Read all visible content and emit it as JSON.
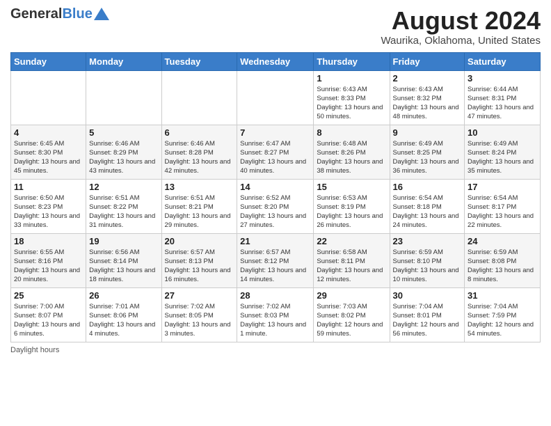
{
  "header": {
    "logo_general": "General",
    "logo_blue": "Blue",
    "main_title": "August 2024",
    "subtitle": "Waurika, Oklahoma, United States"
  },
  "calendar": {
    "days_of_week": [
      "Sunday",
      "Monday",
      "Tuesday",
      "Wednesday",
      "Thursday",
      "Friday",
      "Saturday"
    ],
    "weeks": [
      [
        {
          "day": "",
          "info": ""
        },
        {
          "day": "",
          "info": ""
        },
        {
          "day": "",
          "info": ""
        },
        {
          "day": "",
          "info": ""
        },
        {
          "day": "1",
          "info": "Sunrise: 6:43 AM\nSunset: 8:33 PM\nDaylight: 13 hours and 50 minutes."
        },
        {
          "day": "2",
          "info": "Sunrise: 6:43 AM\nSunset: 8:32 PM\nDaylight: 13 hours and 48 minutes."
        },
        {
          "day": "3",
          "info": "Sunrise: 6:44 AM\nSunset: 8:31 PM\nDaylight: 13 hours and 47 minutes."
        }
      ],
      [
        {
          "day": "4",
          "info": "Sunrise: 6:45 AM\nSunset: 8:30 PM\nDaylight: 13 hours and 45 minutes."
        },
        {
          "day": "5",
          "info": "Sunrise: 6:46 AM\nSunset: 8:29 PM\nDaylight: 13 hours and 43 minutes."
        },
        {
          "day": "6",
          "info": "Sunrise: 6:46 AM\nSunset: 8:28 PM\nDaylight: 13 hours and 42 minutes."
        },
        {
          "day": "7",
          "info": "Sunrise: 6:47 AM\nSunset: 8:27 PM\nDaylight: 13 hours and 40 minutes."
        },
        {
          "day": "8",
          "info": "Sunrise: 6:48 AM\nSunset: 8:26 PM\nDaylight: 13 hours and 38 minutes."
        },
        {
          "day": "9",
          "info": "Sunrise: 6:49 AM\nSunset: 8:25 PM\nDaylight: 13 hours and 36 minutes."
        },
        {
          "day": "10",
          "info": "Sunrise: 6:49 AM\nSunset: 8:24 PM\nDaylight: 13 hours and 35 minutes."
        }
      ],
      [
        {
          "day": "11",
          "info": "Sunrise: 6:50 AM\nSunset: 8:23 PM\nDaylight: 13 hours and 33 minutes."
        },
        {
          "day": "12",
          "info": "Sunrise: 6:51 AM\nSunset: 8:22 PM\nDaylight: 13 hours and 31 minutes."
        },
        {
          "day": "13",
          "info": "Sunrise: 6:51 AM\nSunset: 8:21 PM\nDaylight: 13 hours and 29 minutes."
        },
        {
          "day": "14",
          "info": "Sunrise: 6:52 AM\nSunset: 8:20 PM\nDaylight: 13 hours and 27 minutes."
        },
        {
          "day": "15",
          "info": "Sunrise: 6:53 AM\nSunset: 8:19 PM\nDaylight: 13 hours and 26 minutes."
        },
        {
          "day": "16",
          "info": "Sunrise: 6:54 AM\nSunset: 8:18 PM\nDaylight: 13 hours and 24 minutes."
        },
        {
          "day": "17",
          "info": "Sunrise: 6:54 AM\nSunset: 8:17 PM\nDaylight: 13 hours and 22 minutes."
        }
      ],
      [
        {
          "day": "18",
          "info": "Sunrise: 6:55 AM\nSunset: 8:16 PM\nDaylight: 13 hours and 20 minutes."
        },
        {
          "day": "19",
          "info": "Sunrise: 6:56 AM\nSunset: 8:14 PM\nDaylight: 13 hours and 18 minutes."
        },
        {
          "day": "20",
          "info": "Sunrise: 6:57 AM\nSunset: 8:13 PM\nDaylight: 13 hours and 16 minutes."
        },
        {
          "day": "21",
          "info": "Sunrise: 6:57 AM\nSunset: 8:12 PM\nDaylight: 13 hours and 14 minutes."
        },
        {
          "day": "22",
          "info": "Sunrise: 6:58 AM\nSunset: 8:11 PM\nDaylight: 13 hours and 12 minutes."
        },
        {
          "day": "23",
          "info": "Sunrise: 6:59 AM\nSunset: 8:10 PM\nDaylight: 13 hours and 10 minutes."
        },
        {
          "day": "24",
          "info": "Sunrise: 6:59 AM\nSunset: 8:08 PM\nDaylight: 13 hours and 8 minutes."
        }
      ],
      [
        {
          "day": "25",
          "info": "Sunrise: 7:00 AM\nSunset: 8:07 PM\nDaylight: 13 hours and 6 minutes."
        },
        {
          "day": "26",
          "info": "Sunrise: 7:01 AM\nSunset: 8:06 PM\nDaylight: 13 hours and 4 minutes."
        },
        {
          "day": "27",
          "info": "Sunrise: 7:02 AM\nSunset: 8:05 PM\nDaylight: 13 hours and 3 minutes."
        },
        {
          "day": "28",
          "info": "Sunrise: 7:02 AM\nSunset: 8:03 PM\nDaylight: 13 hours and 1 minute."
        },
        {
          "day": "29",
          "info": "Sunrise: 7:03 AM\nSunset: 8:02 PM\nDaylight: 12 hours and 59 minutes."
        },
        {
          "day": "30",
          "info": "Sunrise: 7:04 AM\nSunset: 8:01 PM\nDaylight: 12 hours and 56 minutes."
        },
        {
          "day": "31",
          "info": "Sunrise: 7:04 AM\nSunset: 7:59 PM\nDaylight: 12 hours and 54 minutes."
        }
      ]
    ]
  },
  "footer": {
    "note": "Daylight hours"
  },
  "colors": {
    "header_bg": "#3a7dc9",
    "accent": "#3a7dc9"
  }
}
